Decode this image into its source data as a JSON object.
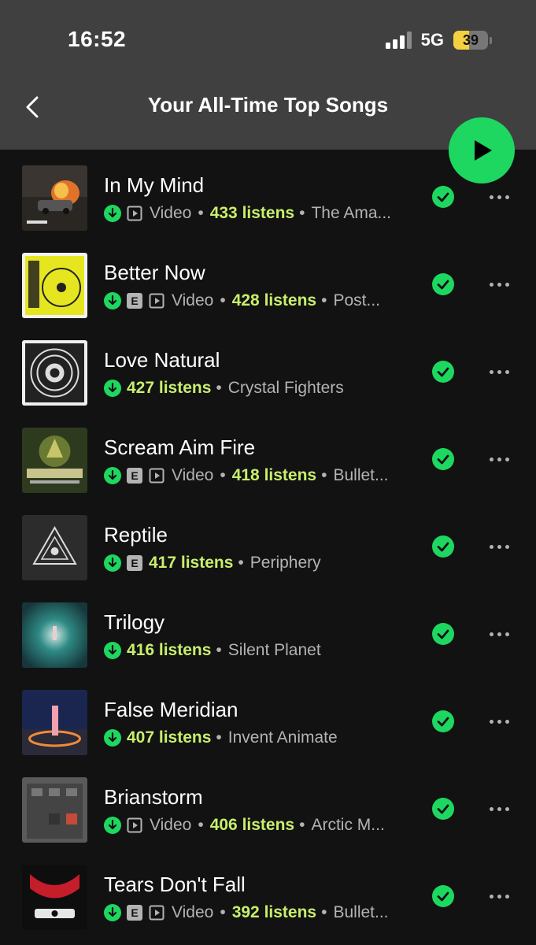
{
  "status_bar": {
    "time": "16:52",
    "network": "5G",
    "battery": "39"
  },
  "header": {
    "title": "Your All-Time Top Songs"
  },
  "labels": {
    "video": "Video",
    "explicit": "E",
    "separator": "•"
  },
  "colors": {
    "accent_green": "#1ed760",
    "listens_color": "#c8ef6c",
    "background": "#121212",
    "header_bg": "#404040"
  },
  "songs": [
    {
      "title": "In My Mind",
      "explicit": false,
      "video": true,
      "listens": "433 listens",
      "artist": "The Ama...",
      "cover": "car-fire"
    },
    {
      "title": "Better Now",
      "explicit": true,
      "video": true,
      "listens": "428 listens",
      "artist": "Post...",
      "cover": "yellow-cd"
    },
    {
      "title": "Love Natural",
      "explicit": false,
      "video": false,
      "listens": "427 listens",
      "artist": "Crystal Fighters",
      "cover": "mandala"
    },
    {
      "title": "Scream Aim Fire",
      "explicit": true,
      "video": true,
      "listens": "418 listens",
      "artist": "Bullet...",
      "cover": "green-emblem"
    },
    {
      "title": "Reptile",
      "explicit": true,
      "video": false,
      "listens": "417 listens",
      "artist": "Periphery",
      "cover": "triangle"
    },
    {
      "title": "Trilogy",
      "explicit": false,
      "video": false,
      "listens": "416 listens",
      "artist": "Silent Planet",
      "cover": "tunnel"
    },
    {
      "title": "False Meridian",
      "explicit": false,
      "video": false,
      "listens": "407 listens",
      "artist": "Invent Animate",
      "cover": "fire-ring"
    },
    {
      "title": "Brianstorm",
      "explicit": false,
      "video": true,
      "listens": "406 listens",
      "artist": "Arctic M...",
      "cover": "building"
    },
    {
      "title": "Tears Don't Fall",
      "explicit": true,
      "video": true,
      "listens": "392 listens",
      "artist": "Bullet...",
      "cover": "red-crest"
    }
  ]
}
